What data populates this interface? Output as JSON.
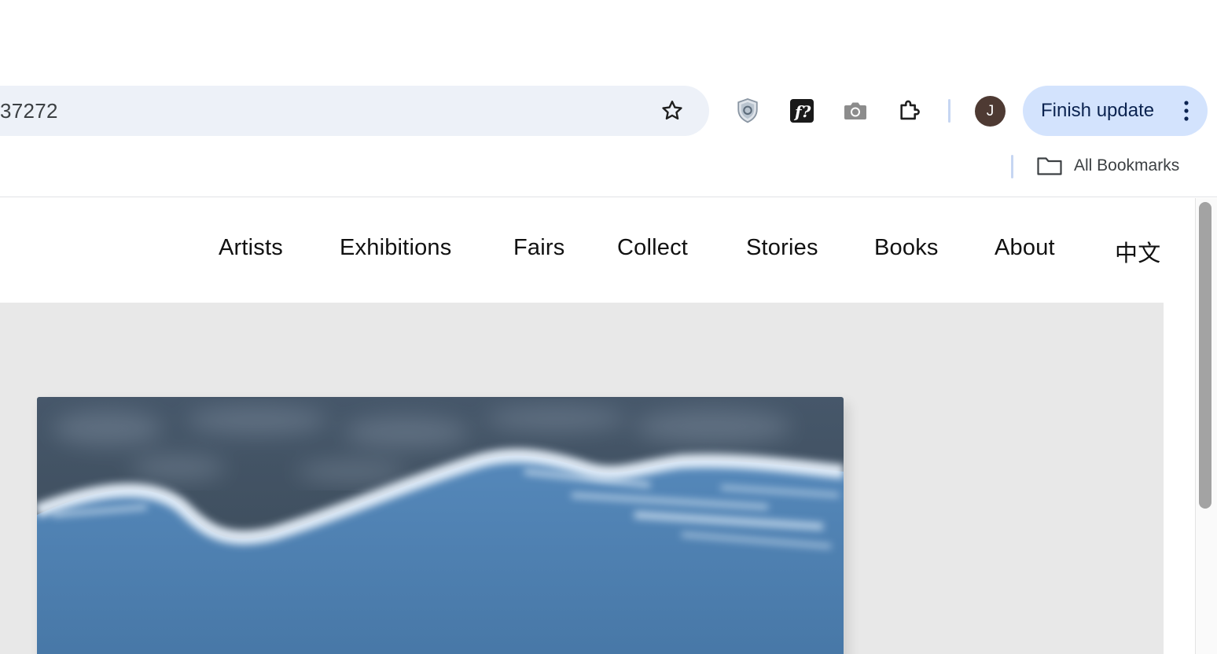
{
  "browser": {
    "url_text": "37272",
    "finish_update_label": "Finish update",
    "profile_initial": "J",
    "bookmarks_label": "All Bookmarks",
    "toolbar_icons": [
      "star-icon",
      "shield-extension-icon",
      "font-identifier-extension-icon",
      "camera-extension-icon",
      "puzzle-extensions-icon",
      "more-vert-icon",
      "folder-icon"
    ]
  },
  "site": {
    "nav": [
      {
        "label": "Artists"
      },
      {
        "label": "Exhibitions"
      },
      {
        "label": "Fairs"
      },
      {
        "label": "Collect"
      },
      {
        "label": "Stories"
      },
      {
        "label": "Books"
      },
      {
        "label": "About"
      },
      {
        "label": "中文"
      }
    ]
  },
  "colors": {
    "omnibox_bg": "#edf1f8",
    "update_button_bg": "#d3e3fd",
    "hero_bg": "#e8e8e8",
    "sky_dark": "#3f4f5d",
    "water_blue": "#4c7eae"
  }
}
